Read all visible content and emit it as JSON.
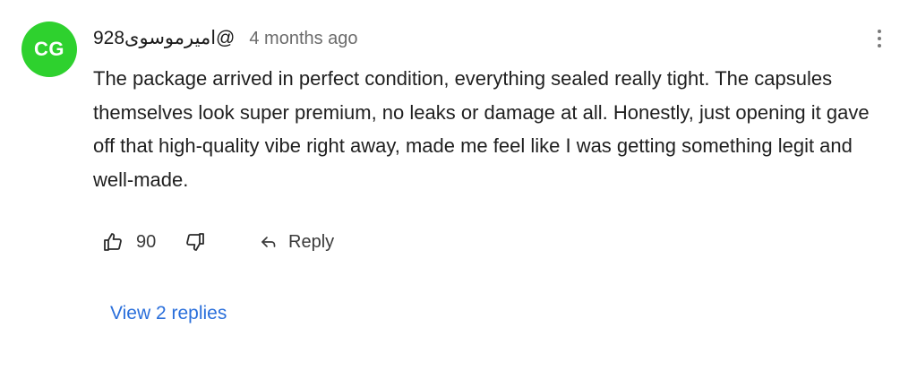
{
  "comment": {
    "avatar_initials": "CG",
    "avatar_color": "#2ed12e",
    "username": "@امیرموسوی928",
    "timestamp": "4 months ago",
    "text": "The package arrived in perfect condition, everything sealed really tight. The capsules themselves look super premium, no leaks or damage at all. Honestly, just opening it gave off that high-quality vibe right away, made me feel like I was getting something legit and well-made.",
    "like_count": "90",
    "reply_label": "Reply",
    "view_replies_label": "View 2 replies",
    "link_color": "#2a6fdb"
  },
  "icons": {
    "like": "thumbs-up-icon",
    "dislike": "thumbs-down-icon",
    "reply": "reply-arrow-icon",
    "more": "more-vertical-icon"
  }
}
